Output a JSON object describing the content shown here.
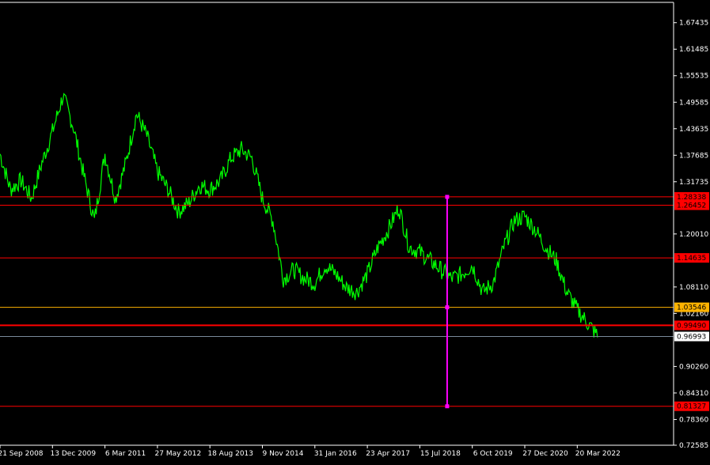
{
  "chart_data": {
    "type": "line",
    "colors": {
      "background": "#000000",
      "frame": "#ffffff",
      "price": "#00ff00",
      "level_line": "#ff0000",
      "level_label_bg": "#ff0000",
      "orange_level": "#ffb300",
      "current_price_label_bg": "#ffffff",
      "current_price_line": "#7a8a9a",
      "vertical_tool": "#ff00ff"
    },
    "y_axis": {
      "ylim": [
        0.7258,
        1.72
      ],
      "ticks": [
        "1.67435",
        "1.61485",
        "1.55535",
        "1.49585",
        "1.43635",
        "1.37685",
        "1.31735",
        "1.20010",
        "1.08110",
        "1.02160",
        "0.90260",
        "0.84310",
        "0.78360",
        "0.72585"
      ]
    },
    "x_axis": {
      "labels": [
        "21 Sep 2008",
        "13 Dec 2009",
        "6 Mar 2011",
        "27 May 2012",
        "18 Aug 2013",
        "9 Nov 2014",
        "31 Jan 2016",
        "23 Apr 2017",
        "15 Jul 2018",
        "6 Oct 2019",
        "27 Dec 2020",
        "20 Mar 2022"
      ]
    },
    "levels": [
      {
        "value": 1.28338,
        "label": "1.28338",
        "kind": "red"
      },
      {
        "value": 1.26452,
        "label": "1.26452",
        "kind": "red"
      },
      {
        "value": 1.14635,
        "label": "1.14635",
        "kind": "red"
      },
      {
        "value": 1.03546,
        "label": "1.03546",
        "kind": "orange"
      },
      {
        "value": 0.9949,
        "label": "0.99490",
        "kind": "red-thick"
      },
      {
        "value": 0.96993,
        "label": "0.96993",
        "kind": "current"
      },
      {
        "value": 0.81327,
        "label": "0.81327",
        "kind": "red"
      }
    ],
    "vertical_tool": {
      "x_label_index": 8.4,
      "top": 1.28338,
      "mid": 1.03546,
      "bottom": 0.81327
    },
    "series": [
      {
        "x": [
          0,
          0.2,
          0.4,
          0.6,
          0.8,
          1.0,
          1.2,
          1.4,
          1.6,
          1.8,
          2.0,
          2.2,
          2.4,
          2.6,
          2.8,
          3.0,
          3.2,
          3.4,
          3.6,
          3.8,
          4.0,
          4.2,
          4.4,
          4.6,
          4.8,
          5.0,
          5.2,
          5.4,
          5.6,
          5.8,
          6.0,
          6.2,
          6.4,
          6.6,
          6.8,
          7.0,
          7.2,
          7.4,
          7.6,
          7.8,
          8.0,
          8.2,
          8.4,
          8.6,
          8.8,
          9.0,
          9.2,
          9.4,
          9.6,
          9.8,
          10.0,
          10.2,
          10.4,
          10.6,
          10.8,
          11.0,
          11.2,
          11.4
        ],
        "values": [
          1.38,
          1.3,
          1.32,
          1.28,
          1.36,
          1.43,
          1.51,
          1.44,
          1.33,
          1.23,
          1.38,
          1.28,
          1.36,
          1.47,
          1.42,
          1.34,
          1.3,
          1.25,
          1.27,
          1.31,
          1.3,
          1.32,
          1.37,
          1.39,
          1.37,
          1.28,
          1.23,
          1.1,
          1.12,
          1.1,
          1.09,
          1.13,
          1.11,
          1.08,
          1.07,
          1.11,
          1.17,
          1.21,
          1.26,
          1.17,
          1.16,
          1.14,
          1.12,
          1.1,
          1.11,
          1.13,
          1.07,
          1.09,
          1.17,
          1.23,
          1.24,
          1.21,
          1.17,
          1.14,
          1.07,
          1.03,
          1.0,
          0.97
        ]
      }
    ]
  }
}
